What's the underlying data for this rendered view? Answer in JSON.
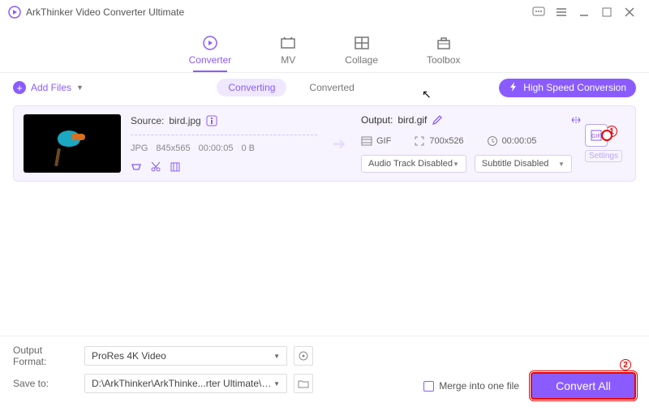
{
  "app_title": "ArkThinker Video Converter Ultimate",
  "tabs": {
    "converter": "Converter",
    "mv": "MV",
    "collage": "Collage",
    "toolbox": "Toolbox"
  },
  "subbar": {
    "add_files": "Add Files",
    "converting": "Converting",
    "converted": "Converted",
    "high_speed": "High Speed Conversion"
  },
  "file": {
    "source_label": "Source:",
    "source_name": "bird.jpg",
    "src_format": "JPG",
    "src_res": "845x565",
    "src_dur": "00:00:05",
    "src_size": "0 B",
    "output_label": "Output:",
    "output_name": "bird.gif",
    "out_format": "GIF",
    "out_res": "700x526",
    "out_dur": "00:00:05",
    "audio_dd": "Audio Track Disabled",
    "subtitle_dd": "Subtitle Disabled",
    "settings_label": "Settings"
  },
  "callouts": {
    "one": "1",
    "two": "2"
  },
  "bottom": {
    "output_format_label": "Output Format:",
    "output_format_value": "ProRes 4K Video",
    "save_to_label": "Save to:",
    "save_to_value": "D:\\ArkThinker\\ArkThinke...rter Ultimate\\Converted",
    "merge_label": "Merge into one file",
    "convert_all": "Convert All"
  }
}
